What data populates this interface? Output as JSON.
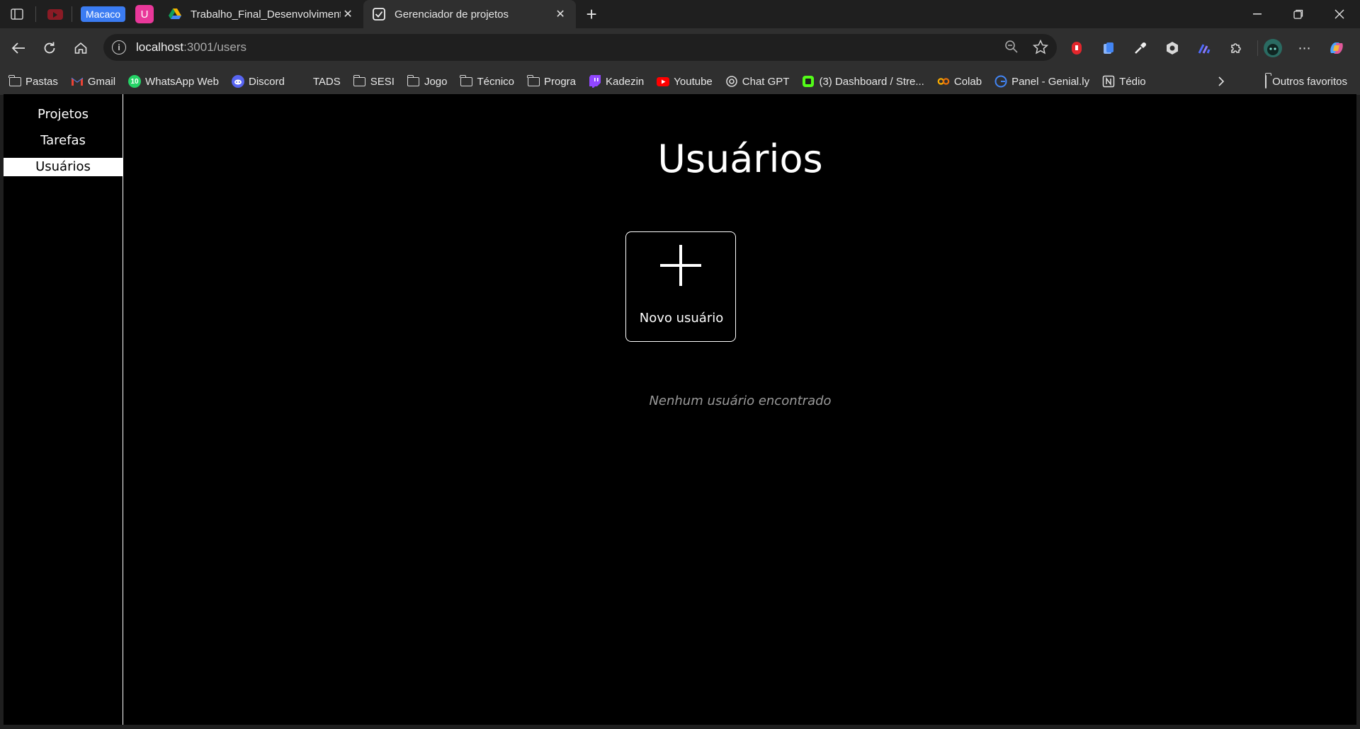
{
  "browser": {
    "group_chip": "Macaco",
    "u_pin_letter": "U",
    "tabs": [
      {
        "title": "Trabalho_Final_Desenvolvimento_",
        "active": false
      },
      {
        "title": "Gerenciador de projetos",
        "active": true
      }
    ],
    "url_host": "localhost",
    "url_rest": ":3001/users",
    "wa_badge": "10",
    "bookmarks": [
      {
        "label": "Pastas",
        "icon": "folder-icon"
      },
      {
        "label": "Gmail",
        "icon": "gmail-icon"
      },
      {
        "label": "WhatsApp Web",
        "icon": "whatsapp-icon"
      },
      {
        "label": "Discord",
        "icon": "discord-icon"
      },
      {
        "label": "TADS",
        "icon": "none"
      },
      {
        "label": "SESI",
        "icon": "folder-icon"
      },
      {
        "label": "Jogo",
        "icon": "folder-icon"
      },
      {
        "label": "Técnico",
        "icon": "folder-icon"
      },
      {
        "label": "Progra",
        "icon": "folder-icon"
      },
      {
        "label": "Kadezin",
        "icon": "twitch-icon"
      },
      {
        "label": "Youtube",
        "icon": "youtube-icon"
      },
      {
        "label": "Chat GPT",
        "icon": "openai-icon"
      },
      {
        "label": "(3) Dashboard / Stre...",
        "icon": "dashboard-icon"
      },
      {
        "label": "Colab",
        "icon": "colab-icon"
      },
      {
        "label": "Panel - Genial.ly",
        "icon": "genially-icon"
      },
      {
        "label": "Tédio",
        "icon": "notion-icon"
      }
    ],
    "other_favorites": "Outros favoritos"
  },
  "app": {
    "sidebar": [
      {
        "label": "Projetos",
        "active": false
      },
      {
        "label": "Tarefas",
        "active": false
      },
      {
        "label": "Usuários",
        "active": true
      }
    ],
    "title": "Usuários",
    "new_user_label": "Novo usuário",
    "empty_message": "Nenhum usuário encontrado"
  },
  "colors": {
    "accent_blue": "#3b7cf2",
    "page_background": "#000000",
    "sidebar_active_bg": "#ffffff",
    "empty_text": "#9a9a9a"
  }
}
